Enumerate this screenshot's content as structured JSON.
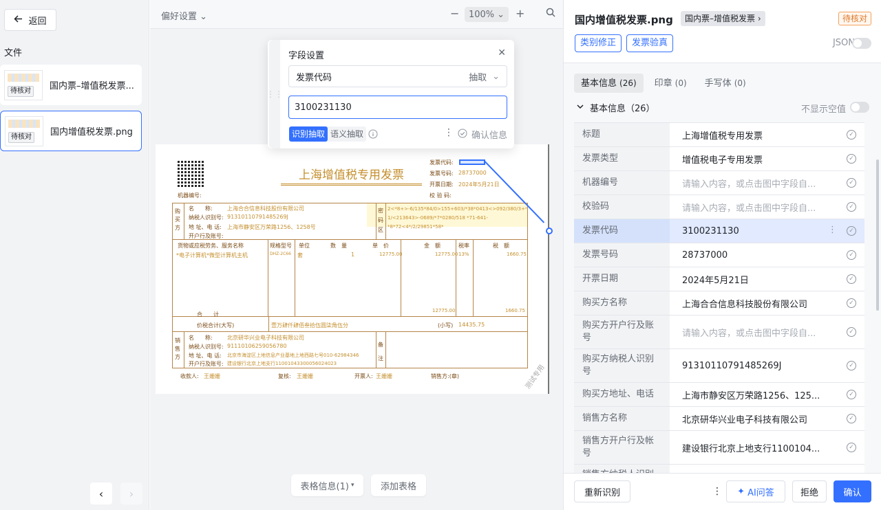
{
  "sidebar": {
    "back_label": "返回",
    "files_label": "文件",
    "files": [
      {
        "name": "国内票–增值税发票...",
        "status": "待核对"
      },
      {
        "name": "国内增值税发票.png",
        "status": "待核对"
      }
    ],
    "prev": "‹",
    "next": "›"
  },
  "toolbar": {
    "preferences": "偏好设置",
    "zoom": "100%",
    "zoom_out": "−",
    "zoom_in": "+"
  },
  "popup": {
    "title": "字段设置",
    "field": "发票代码",
    "mode": "抽取",
    "value": "3100231130",
    "tab_extract": "识别抽取",
    "tab_semantic": "语义抽取",
    "confirm": "确认信息"
  },
  "invoice": {
    "title": "上海增值税专用发票",
    "code_label": "发票代码:",
    "number_label": "发票号码:",
    "number": "28737000",
    "date_label": "开票日期:",
    "date": "2024年5月21日",
    "check_label": "校 验 码:",
    "machine_label": "机器编号:",
    "buyer_section": "购买方",
    "buyer_name_label": "名　　称:",
    "buyer_name": "上海合合信息科技股份有限公司",
    "buyer_tax_label": "纳税人识别号:",
    "buyer_tax": "91310110791485269J",
    "buyer_addr_label": "地 址、电 话:",
    "buyer_addr": "上海市静安区万荣路1256、1258号",
    "buyer_bank_label": "开户行及账号:",
    "cipher_label": "密码区",
    "cipher": "2<*8+>-6/135*84/0>155+603/*38*0413<>092/380/3+*/-7/ 1/<213643>-0689/*7*0280/518 *71-641-*8*72<4*/2/29851*58*",
    "goods_label": "货物或应税劳务、服务名称",
    "spec_label": "规格型号",
    "unit_label": "单位",
    "qty_label": "数　量",
    "price_label": "单　价",
    "amount_label": "金　额",
    "rate_label": "税率",
    "tax_label": "税　额",
    "item": "*电子计算机*微型计算机主机",
    "item_spec": "DHZ-2C66",
    "item_unit": "套",
    "item_qty": "1",
    "item_price": "12775.00",
    "item_amount": "12775.00",
    "item_rate": "13%",
    "item_tax": "1660.75",
    "total_label": "合　　计",
    "total_amount": "12775.00",
    "total_tax": "1660.75",
    "sum_label": "价税合计(大写)",
    "sum_text": "壹万肆仟肆佰叁拾伍圆柒角伍分",
    "sum_small_label": "(小写)",
    "sum_small": "14435.75",
    "seller_section": "销售方",
    "seller_name": "北京研华兴业电子科技有限公司",
    "seller_tax": "91110106259056780",
    "seller_addr": "北京市海淀区上地信息产业基地上地西路七号010-62984346",
    "seller_bank": "建设银行北京上地支行11001043300056024023",
    "remark_label": "备注",
    "payee_label": "收款人:",
    "payee": "王姗姗",
    "review_label": "复核:",
    "review": "王姗姗",
    "drawer_label": "开票人:",
    "drawer": "王姗姗",
    "seller_stamp_label": "销售方:(章)",
    "watermark": "测试专用"
  },
  "bottom": {
    "table_info": "表格信息(1)",
    "add_table": "添加表格"
  },
  "right": {
    "title": "国内增值税发票.png",
    "tag": "国内票–增值税发票",
    "status": "待核对",
    "btn_correct": "类别修正",
    "btn_verify": "发票验真",
    "json_label": "JSON",
    "tabs": [
      {
        "label": "基本信息",
        "count": "(26)"
      },
      {
        "label": "印章",
        "count": "(0)"
      },
      {
        "label": "手写体",
        "count": "(0)"
      }
    ],
    "section": "基本信息（26）",
    "hide_empty": "不显示空值",
    "rows": [
      {
        "k": "标题",
        "v": "上海增值税专用发票"
      },
      {
        "k": "发票类型",
        "v": "增值税电子专用发票"
      },
      {
        "k": "机器编号",
        "v": "请输入内容，或点击图中字段自..."
      },
      {
        "k": "校验码",
        "v": "请输入内容，或点击图中字段自..."
      },
      {
        "k": "发票代码",
        "v": "3100231130"
      },
      {
        "k": "发票号码",
        "v": "28737000"
      },
      {
        "k": "开票日期",
        "v": "2024年5月21日"
      },
      {
        "k": "购买方名称",
        "v": "上海合合信息科技股份有限公司"
      },
      {
        "k": "购买方开户行及账号",
        "v": "请输入内容，或点击图中字段自..."
      },
      {
        "k": "购买方纳税人识别号",
        "v": "91310110791485269J"
      },
      {
        "k": "购买方地址、电话",
        "v": "上海市静安区万荣路1256、125..."
      },
      {
        "k": "销售方名称",
        "v": "北京研华兴业电子科技有限公司"
      },
      {
        "k": "销售方开户行及帐号",
        "v": "建设银行北京上地支行1100104..."
      },
      {
        "k": "销售方纳税人识别号",
        "v": ""
      }
    ],
    "footer": {
      "re_recognize": "重新识别",
      "ai": "AI问答",
      "reject": "拒绝",
      "confirm": "确认"
    }
  }
}
